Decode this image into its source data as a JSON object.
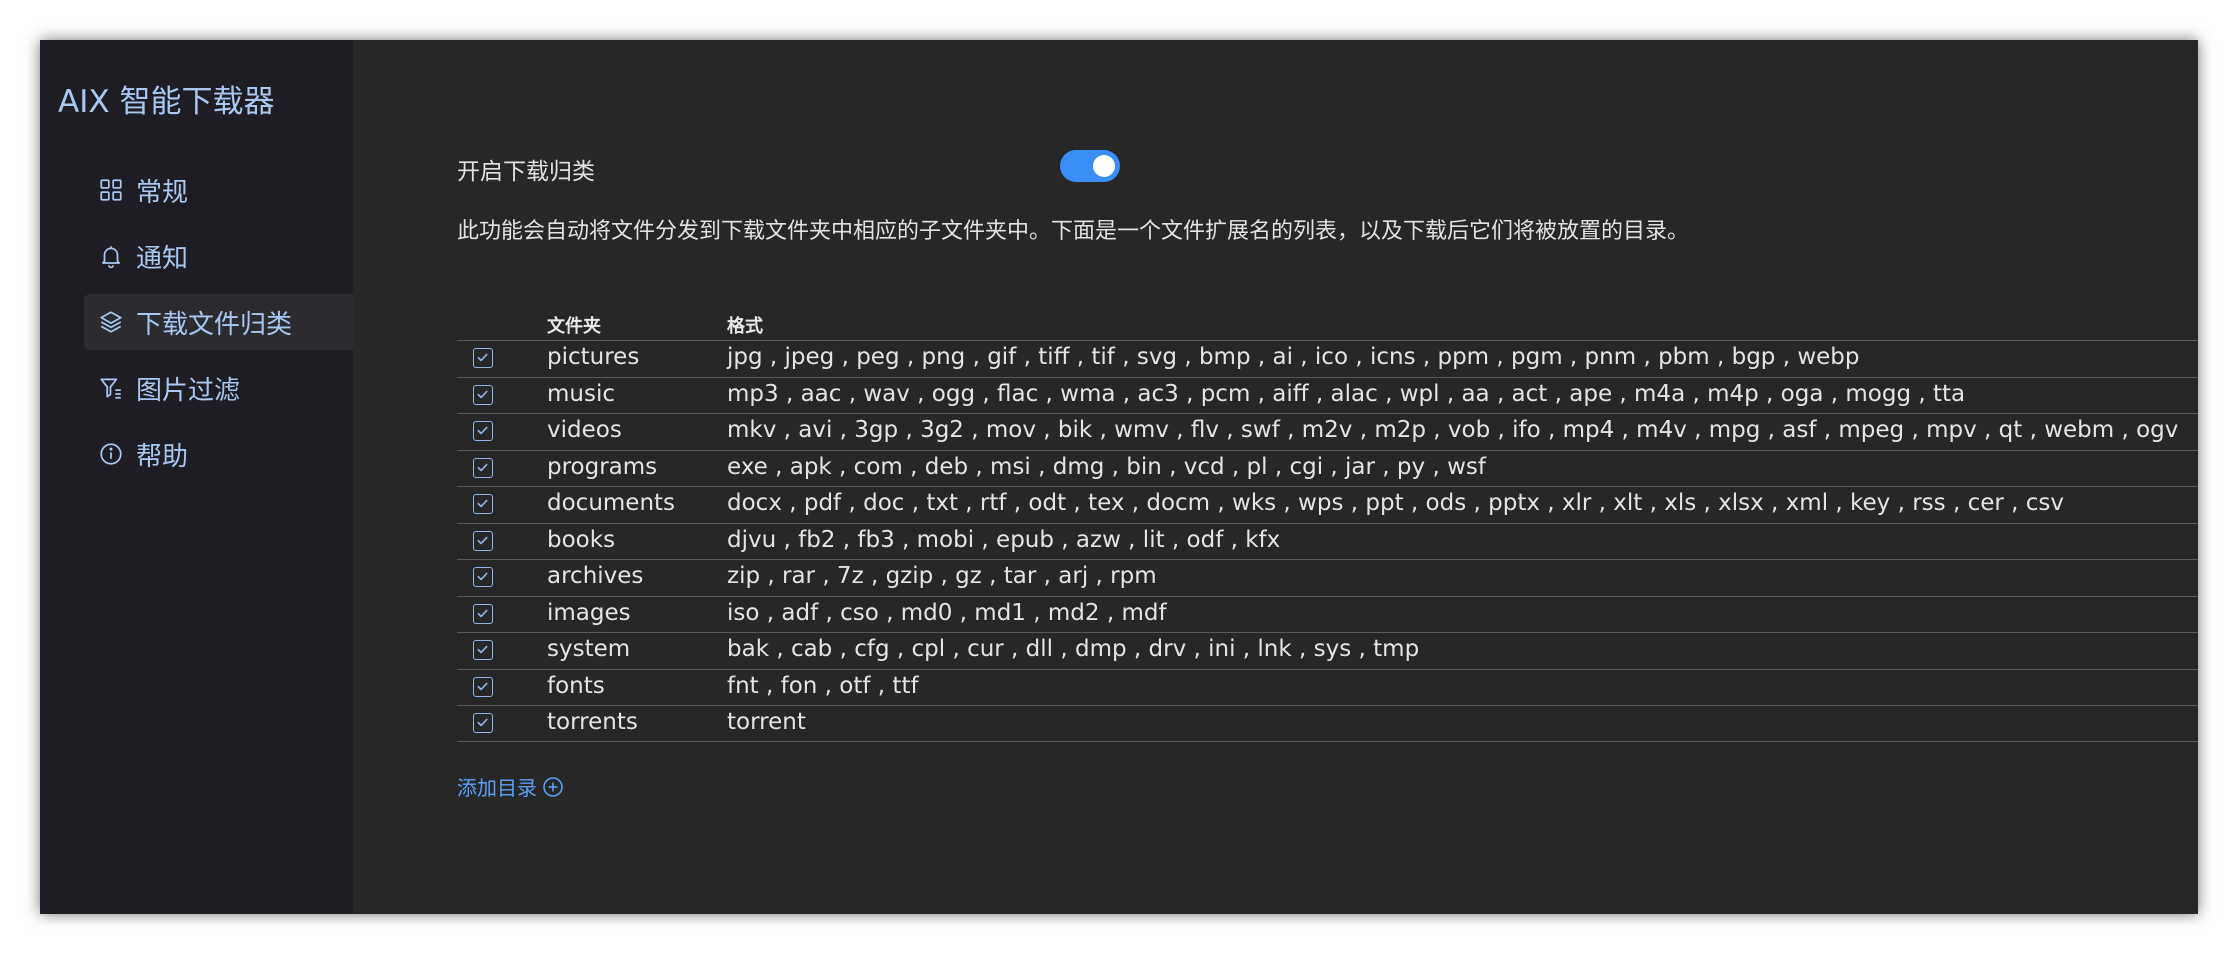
{
  "app": {
    "title": "AIX 智能下载器"
  },
  "sidebar": {
    "items": [
      {
        "label": "常规",
        "icon": "grid-icon",
        "active": false
      },
      {
        "label": "通知",
        "icon": "bell-icon",
        "active": false
      },
      {
        "label": "下载文件归类",
        "icon": "layers-icon",
        "active": true
      },
      {
        "label": "图片过滤",
        "icon": "filter-icon",
        "active": false
      },
      {
        "label": "帮助",
        "icon": "info-icon",
        "active": false
      }
    ]
  },
  "settings": {
    "toggle_label": "开启下载归类",
    "toggle_on": true,
    "description": "此功能会自动将文件分发到下载文件夹中相应的子文件夹中。下面是一个文件扩展名的列表，以及下载后它们将被放置的目录。"
  },
  "table": {
    "headers": {
      "folder": "文件夹",
      "formats": "格式"
    },
    "rows": [
      {
        "checked": true,
        "folder": "pictures",
        "formats": "jpg , jpeg , peg , png , gif , tiff , tif , svg , bmp , ai , ico , icns , ppm , pgm , pnm , pbm , bgp , webp"
      },
      {
        "checked": true,
        "folder": "music",
        "formats": "mp3 , aac , wav , ogg , flac , wma , ac3 , pcm , aiff , alac , wpl , aa , act , ape , m4a , m4p , oga , mogg , tta"
      },
      {
        "checked": true,
        "folder": "videos",
        "formats": "mkv , avi , 3gp , 3g2 , mov , bik , wmv , flv , swf , m2v , m2p , vob , ifo , mp4 , m4v , mpg , asf , mpeg , mpv , qt , webm , ogv"
      },
      {
        "checked": true,
        "folder": "programs",
        "formats": "exe , apk , com , deb , msi , dmg , bin , vcd , pl , cgi , jar , py , wsf"
      },
      {
        "checked": true,
        "folder": "documents",
        "formats": "docx , pdf , doc , txt , rtf , odt , tex , docm , wks , wps , ppt , ods , pptx , xlr , xlt , xls , xlsx , xml , key , rss , cer , csv"
      },
      {
        "checked": true,
        "folder": "books",
        "formats": "djvu , fb2 , fb3 , mobi , epub , azw , lit , odf , kfx"
      },
      {
        "checked": true,
        "folder": "archives",
        "formats": "zip , rar , 7z , gzip , gz , tar , arj , rpm"
      },
      {
        "checked": true,
        "folder": "images",
        "formats": "iso , adf , cso , md0 , md1 , md2 , mdf"
      },
      {
        "checked": true,
        "folder": "system",
        "formats": "bak , cab , cfg , cpl , cur , dll , dmp , drv , ini , lnk , sys , tmp"
      },
      {
        "checked": true,
        "folder": "fonts",
        "formats": "fnt , fon , otf , ttf"
      },
      {
        "checked": true,
        "folder": "torrents",
        "formats": "torrent"
      }
    ]
  },
  "actions": {
    "add_directory": "添加目录"
  },
  "colors": {
    "accent": "#3a8ef6",
    "link": "#5aa0f5",
    "sidebar_text": "#a9c7f0",
    "background": "#272727",
    "sidebar_bg": "#1e1d23"
  }
}
